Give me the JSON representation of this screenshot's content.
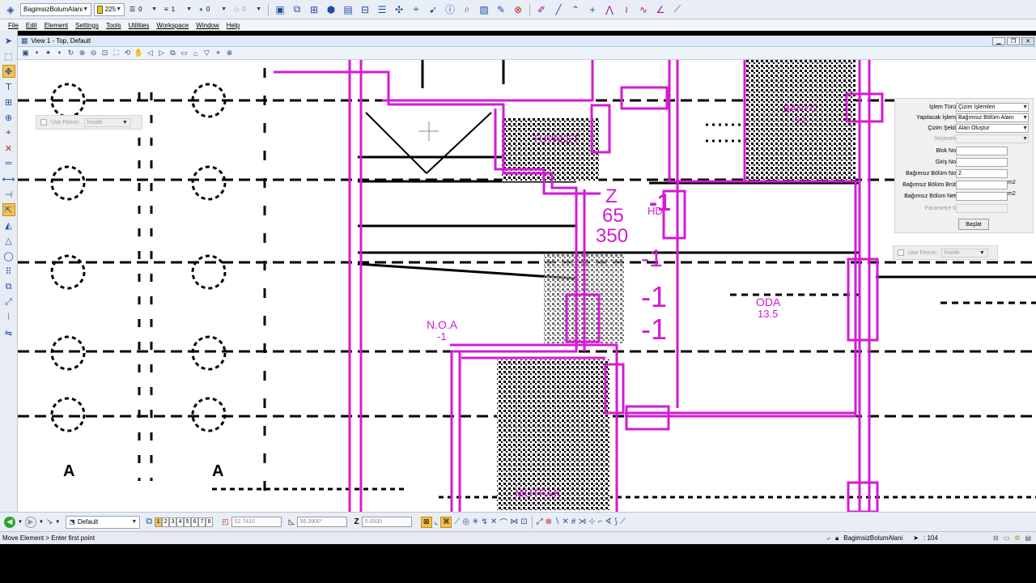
{
  "toolbar": {
    "level": "BagimsizBolumAlani",
    "color_value": "225",
    "color_swatch": "#f2c500",
    "line_style": "0",
    "line_weight": "1",
    "transparency": "0",
    "priority": "0"
  },
  "menu": [
    "File",
    "Edit",
    "Element",
    "Settings",
    "Tools",
    "Utilities",
    "Workspace",
    "Window",
    "Help"
  ],
  "view": {
    "title": "View 1 - Top, Default"
  },
  "fence_left": {
    "label": "Use Fence:",
    "mode": "Inside"
  },
  "fence_right": {
    "label": "Use Fence:",
    "mode": "Inside"
  },
  "tool_settings": {
    "islem_turu": {
      "label": "İşlem Türü",
      "value": "Çizim İşlemleri"
    },
    "yapilacak_islem": {
      "label": "Yapılacak İşlem",
      "value": "Bağımsız Bölüm Alanı"
    },
    "cizim_sekli": {
      "label": "Çizim Şekli",
      "value": "Alan Oluştur"
    },
    "secenek": {
      "label": "Seçenek",
      "value": ""
    },
    "blok_no": {
      "label": "Blok No",
      "value": ""
    },
    "giris_no": {
      "label": "Giriş No",
      "value": ""
    },
    "bagimsiz_bolum_no": {
      "label": "Bağımsız Bölüm No",
      "value": "2"
    },
    "bagimsiz_bolum_brut": {
      "label": "Bağımsız Bölüm Brüt",
      "value": "",
      "unit": "m2"
    },
    "bagimsiz_bolum_net": {
      "label": "Bağımsız Bölüm Net",
      "value": "",
      "unit": "m2"
    },
    "parametre_6": {
      "label": "Parametre 6",
      "value": ""
    },
    "start_button": "Başlat"
  },
  "drawing": {
    "labels": {
      "tuvalet": "TUVALET",
      "banyo": "BANYO",
      "banyo_area": "5.2",
      "z": "Z",
      "n65": "65",
      "n350": "350",
      "hd": "HD",
      "m1a": "-1",
      "m1b": "-1",
      "m1c": "-1",
      "m1d": "-1",
      "oda": "ODA",
      "oda_area": "13.5",
      "noa": "N.O.A",
      "noa_level": "-1",
      "mutfak": "MUTFAK",
      "grid_a1": "A",
      "grid_a2": "A"
    }
  },
  "bottom_bar": {
    "level_display": "Default",
    "view_tabs": [
      "1",
      "2",
      "3",
      "4",
      "5",
      "6",
      "7",
      "8"
    ],
    "x_value": "52.7410",
    "y_value": "56.3900°",
    "z_label": "Z",
    "z_value": "0.0000"
  },
  "status": {
    "prompt": "Move Element > Enter first point",
    "active_level": "BagimsizBolumAlani",
    "selection_count": ": 104"
  }
}
